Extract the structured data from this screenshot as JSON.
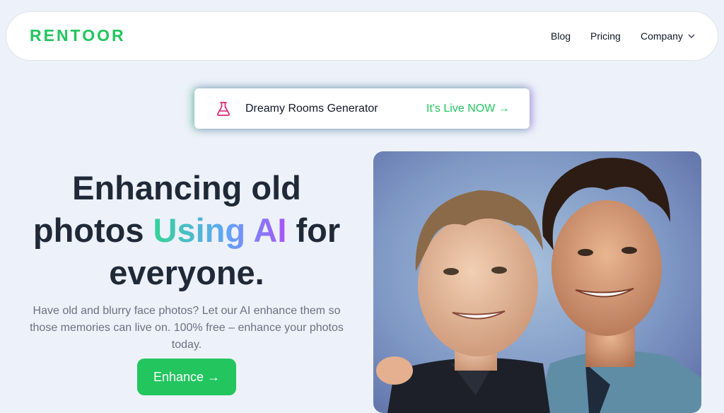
{
  "brand": {
    "logo": "RENTOOR"
  },
  "nav": {
    "blog": "Blog",
    "pricing": "Pricing",
    "company": "Company"
  },
  "banner": {
    "text": "Dreamy Rooms Generator",
    "link": "It's Live NOW →"
  },
  "hero": {
    "title_1": "Enhancing old",
    "title_2a": "photos ",
    "title_highlight": "Using AI",
    "title_2b": " for",
    "title_3": "everyone.",
    "subtitle": "Have old and blurry face photos? Let our AI enhance them so those memories can live on. 100% free – enhance your photos today.",
    "cta": "Enhance →"
  },
  "colors": {
    "accent": "#22c55e",
    "background": "#edf1f9",
    "gradient": [
      "#34d399",
      "#60a5fa",
      "#a855f7"
    ]
  },
  "icons": {
    "banner_icon": "flask-icon",
    "nav_dropdown": "chevron-down-icon"
  }
}
